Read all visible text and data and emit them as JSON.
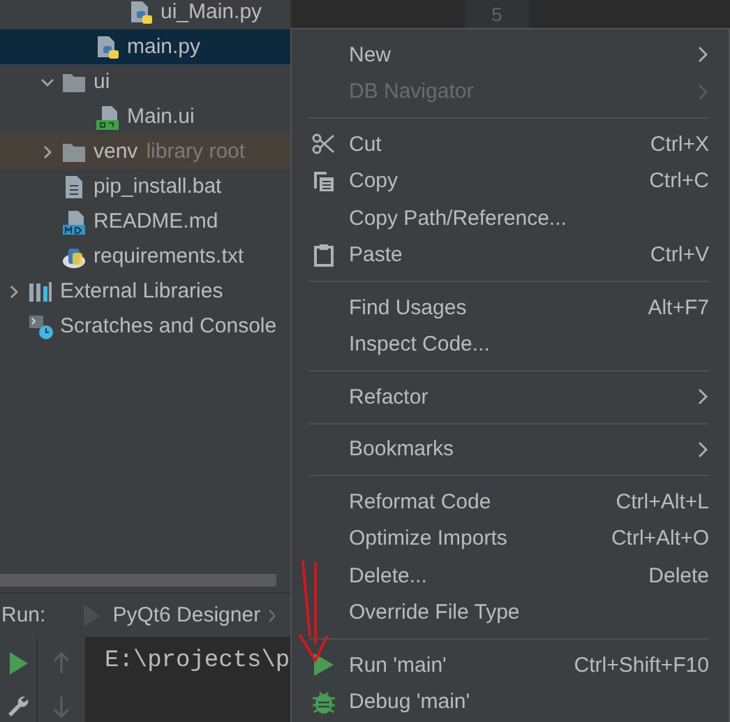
{
  "project_tree": {
    "items": [
      {
        "children": [
          {
            "children": [
              {
                "children": [
                  {
                    "label": "ui_Main.py",
                    "kind": "python",
                    "selected": false
                  }
                ]
              },
              {
                "label": "main.py",
                "kind": "python",
                "selected": true
              }
            ]
          },
          {
            "label": "ui",
            "kind": "folder",
            "expanded": true,
            "selected": false,
            "children": [
              {
                "label": "Main.ui",
                "kind": "qt",
                "selected": false
              }
            ]
          },
          {
            "label": "venv",
            "note": "library root",
            "kind": "excluded_folder",
            "expanded": false,
            "selected": false
          },
          {
            "label": "pip_install.bat",
            "kind": "text",
            "selected": false
          },
          {
            "label": "README.md",
            "kind": "markdown",
            "selected": false
          },
          {
            "label": "requirements.txt",
            "kind": "requirements",
            "selected": false
          }
        ]
      },
      {
        "label": "External Libraries",
        "kind": "libraries",
        "expanded": false,
        "selected": false
      },
      {
        "label": "Scratches and Console",
        "kind": "scratches",
        "selected": false
      }
    ]
  },
  "editor": {
    "line_numbers": [
      "5"
    ]
  },
  "run_panel": {
    "title": "Run:",
    "tabs": [
      {
        "label": "PyQt6 Designer",
        "selected": true
      }
    ],
    "console": {
      "lines": [
        "E:\\projects\\p"
      ]
    }
  },
  "context_menu": {
    "items": [
      {
        "kind": "item",
        "label": "New",
        "submenu": true,
        "disabled": false
      },
      {
        "kind": "item",
        "label": "DB Navigator",
        "submenu": true,
        "disabled": true
      },
      {
        "kind": "separator"
      },
      {
        "kind": "cut",
        "label": "Cut",
        "shortcut": "Ctrl+X",
        "submenu": false,
        "disabled": false
      },
      {
        "kind": "copy",
        "label": "Copy",
        "shortcut": "Ctrl+C",
        "submenu": false,
        "disabled": false
      },
      {
        "kind": "item",
        "label": "Copy Path/Reference...",
        "submenu": false,
        "disabled": false
      },
      {
        "kind": "paste",
        "label": "Paste",
        "shortcut": "Ctrl+V",
        "submenu": false,
        "disabled": false
      },
      {
        "kind": "separator"
      },
      {
        "kind": "item",
        "label": "Find Usages",
        "shortcut": "Alt+F7",
        "submenu": false,
        "disabled": false
      },
      {
        "kind": "item",
        "label": "Inspect Code...",
        "submenu": false,
        "disabled": false
      },
      {
        "kind": "separator"
      },
      {
        "kind": "item",
        "label": "Refactor",
        "submenu": true,
        "disabled": false
      },
      {
        "kind": "separator"
      },
      {
        "kind": "item",
        "label": "Bookmarks",
        "submenu": true,
        "disabled": false
      },
      {
        "kind": "separator"
      },
      {
        "kind": "item",
        "label": "Reformat Code",
        "shortcut": "Ctrl+Alt+L",
        "submenu": false,
        "disabled": false
      },
      {
        "kind": "item",
        "label": "Optimize Imports",
        "shortcut": "Ctrl+Alt+O",
        "submenu": false,
        "disabled": false
      },
      {
        "kind": "item",
        "label": "Delete...",
        "shortcut": "Delete",
        "submenu": false,
        "disabled": false
      },
      {
        "kind": "item",
        "label": "Override File Type",
        "submenu": false,
        "disabled": false
      },
      {
        "kind": "separator"
      },
      {
        "kind": "run",
        "label": "Run 'main'",
        "shortcut": "Ctrl+Shift+F10",
        "submenu": false,
        "disabled": false
      },
      {
        "kind": "debug",
        "label": "Debug 'main'",
        "submenu": false,
        "disabled": false
      }
    ]
  }
}
